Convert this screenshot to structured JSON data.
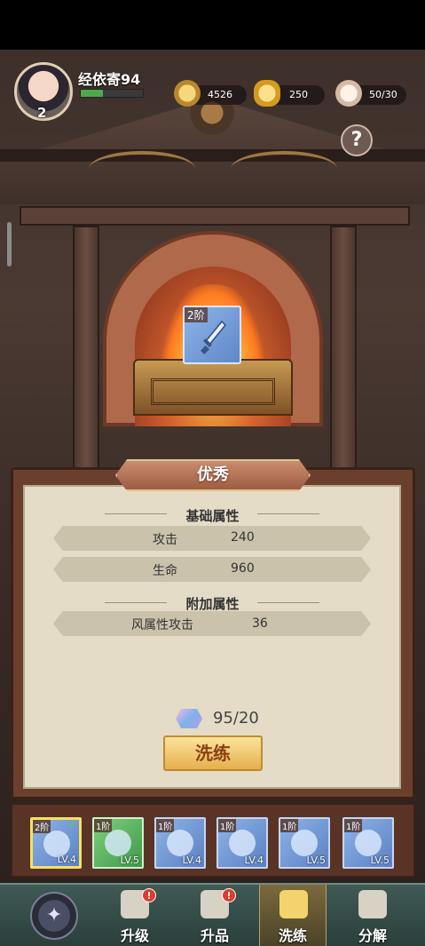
{
  "player": {
    "name": "经依寄94",
    "level": "2",
    "exp_fraction": 0.35
  },
  "resources": [
    {
      "icon": "gold-coin-icon",
      "value": "4526"
    },
    {
      "icon": "gold-ingot-icon",
      "value": "250"
    },
    {
      "icon": "stamina-bun-icon",
      "value": "50/30"
    }
  ],
  "help_label": "?",
  "forge": {
    "item_tier": "2阶"
  },
  "panel": {
    "rarity": "优秀",
    "base_title": "基础属性",
    "extra_title": "附加属性",
    "base_stats": [
      {
        "name": "攻击",
        "value": "240"
      },
      {
        "name": "生命",
        "value": "960"
      }
    ],
    "extra_stats": [
      {
        "name": "风属性攻击",
        "value": "36"
      }
    ],
    "cost": "95/20",
    "refine_button": "洗练"
  },
  "slots": [
    {
      "tier": "2阶",
      "level": "LV.4",
      "color": "blue",
      "selected": true,
      "item": "dagger-icon"
    },
    {
      "tier": "1阶",
      "level": "LV.5",
      "color": "green",
      "selected": false,
      "item": "helmet-icon"
    },
    {
      "tier": "1阶",
      "level": "LV.4",
      "color": "blue",
      "selected": false,
      "item": "bracelet-icon"
    },
    {
      "tier": "1阶",
      "level": "LV.4",
      "color": "blue",
      "selected": false,
      "item": "armor-icon"
    },
    {
      "tier": "1阶",
      "level": "LV.5",
      "color": "blue",
      "selected": false,
      "item": "ring-icon"
    },
    {
      "tier": "1阶",
      "level": "LV.5",
      "color": "blue",
      "selected": false,
      "item": "boots-icon"
    }
  ],
  "nav": [
    {
      "label": "升级",
      "badge": "!",
      "active": false
    },
    {
      "label": "升品",
      "badge": "!",
      "active": false
    },
    {
      "label": "洗练",
      "badge": "",
      "active": true
    },
    {
      "label": "分解",
      "badge": "",
      "active": false
    }
  ],
  "colors": {
    "panel_bg": "#e4dcc6",
    "rarity_banner": "#b27154",
    "button_gold": "#f0c86d",
    "nav_bg": "#35504b"
  }
}
